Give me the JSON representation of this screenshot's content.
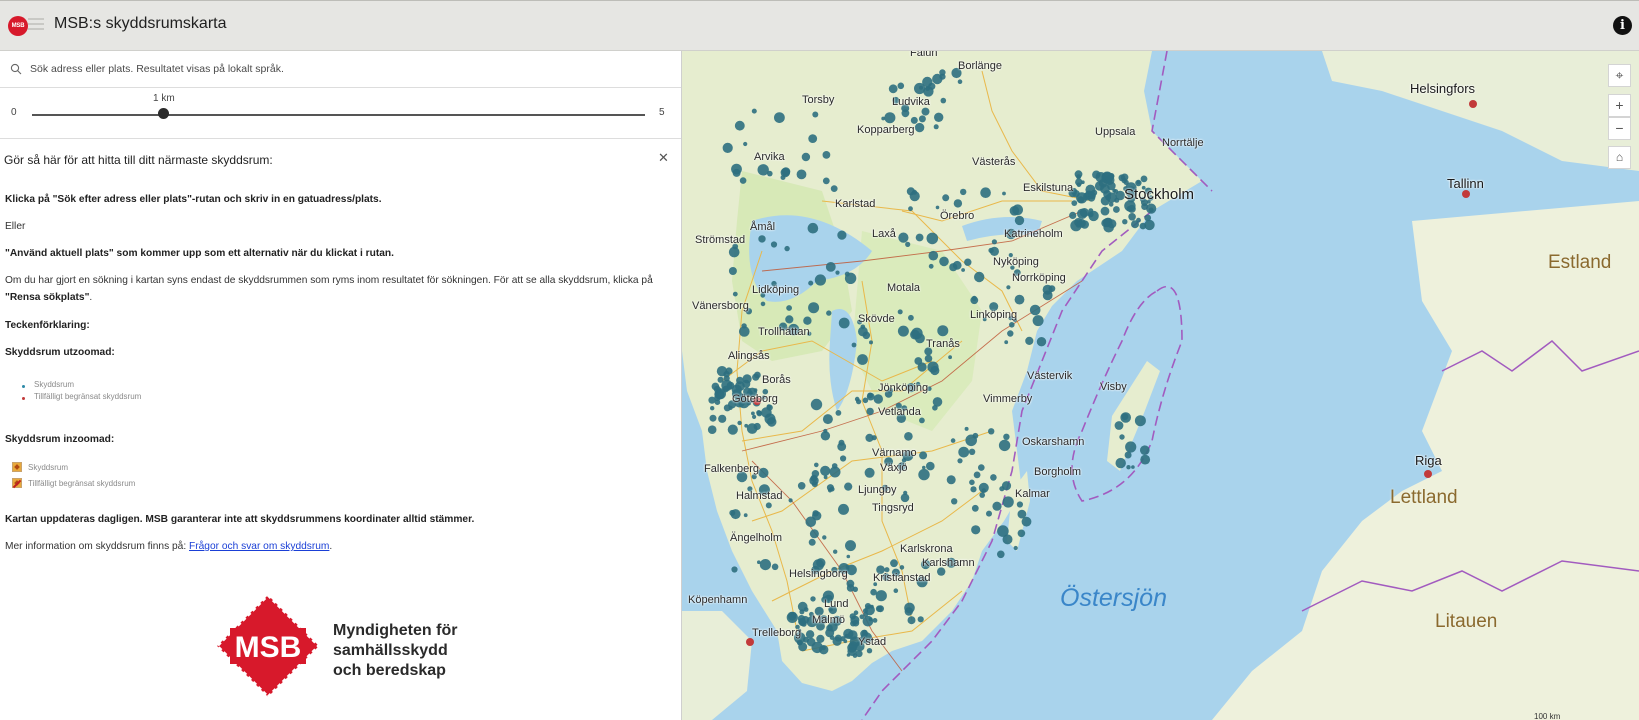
{
  "header": {
    "logo_text": "MSB",
    "title": "MSB:s skyddsrumskarta",
    "info_icon": "info-icon"
  },
  "search": {
    "placeholder": "Sök adress eller plats. Resultatet visas på lokalt språk.",
    "icon": "search-icon"
  },
  "radius_slider": {
    "min_label": "0",
    "max_label": "5",
    "value_label": "1 km",
    "value": 1
  },
  "guide": {
    "heading": "Gör så här för att hitta till ditt närmaste skyddsrum:",
    "step1": "Klicka på \"Sök efter adress eller plats\"-rutan och skriv in en gatuadress/plats.",
    "or": "Eller",
    "step2": "\"Använd aktuell plats\" som kommer upp som ett alternativ när du klickat i rutan.",
    "note_part1": "Om du har gjort en sökning i kartan syns endast de skyddsrummen som ryms inom resultatet för sökningen. För att se alla skyddsrum, klicka på ",
    "note_bold": "\"Rensa sökplats\"",
    "note_end": ".",
    "legend_title": "Teckenförklaring:",
    "zoomed_out_title": "Skyddsrum utzoomad:",
    "zoomed_out_items": [
      "Skyddsrum",
      "Tillfälligt begränsat skyddsrum"
    ],
    "zoomed_in_title": "Skyddsrum inzoomad:",
    "zoomed_in_items": [
      "Skyddsrum",
      "Tillfälligt begränsat skyddsrum"
    ],
    "daily_update": "Kartan uppdateras dagligen. MSB garanterar inte att skyddsrummens koordinater alltid stämmer.",
    "more_info": "Mer information om skyddsrum finns på: ",
    "faq_link": "Frågor och svar om skyddsrum",
    "faq_end": "."
  },
  "msb_logo": {
    "mark_text": "MSB",
    "name_line1": "Myndigheten för",
    "name_line2": "samhällsskydd",
    "name_line3": "och beredskap"
  },
  "map": {
    "cities": [
      "Falun",
      "Borlänge",
      "Torsby",
      "Ludvika",
      "Kopparberg",
      "Uppsala",
      "Norrtälje",
      "Arvika",
      "Västerås",
      "Eskilstuna",
      "Stockholm",
      "Karlstad",
      "Örebro",
      "Åmål",
      "Strömstad",
      "Laxå",
      "Katrineholm",
      "Nyköping",
      "Norrköping",
      "Lidköping",
      "Vänersborg",
      "Motala",
      "Skövde",
      "Linköping",
      "Trollhättan",
      "Alingsås",
      "Borås",
      "Göteborg",
      "Tranås",
      "Västervik",
      "Visby",
      "Jönköping",
      "Vetlanda",
      "Vimmerby",
      "Oskarshamn",
      "Värnamo",
      "Växjö",
      "Falkenberg",
      "Borgholm",
      "Halmstad",
      "Ljungby",
      "Kalmar",
      "Tingsryd",
      "Ängelholm",
      "Karlskrona",
      "Karlshamn",
      "Helsingborg",
      "Kristianstad",
      "Köpenhamn",
      "Lund",
      "Malmö",
      "Trelleborg",
      "Ystad",
      "Helsingfors",
      "Tallinn",
      "Riga"
    ],
    "countries": [
      "Estland",
      "Lettland",
      "Litauen"
    ],
    "sea": "Östersjön",
    "scale": "100 km",
    "controls": {
      "locate": "locate-icon",
      "zoom_in": "+",
      "zoom_out": "−",
      "home": "home-icon"
    }
  },
  "colors": {
    "shelter": "#2e6f80",
    "restricted": "#c23a3a",
    "brand": "#d7192b",
    "sea": "#a9d3ec",
    "land": "#e8eed8"
  }
}
